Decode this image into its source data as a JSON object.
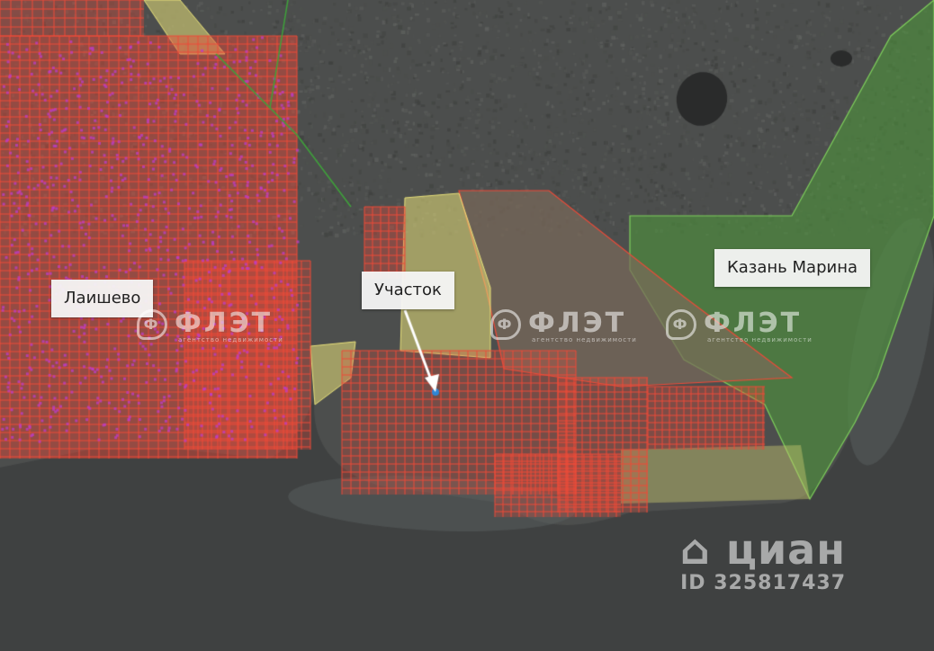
{
  "map": {
    "labels": {
      "town": "Лаишево",
      "plot": "Участок",
      "marina": "Казань Марина"
    },
    "watermarks": {
      "agency_brand": "ФЛЭТ",
      "agency_tagline": "агентство недвижимости",
      "cian_brand": "циан",
      "listing_id": "ID 325817437"
    },
    "colors": {
      "water": "#3f4141",
      "forest": "#4c4e4d",
      "parcel_red": "#ee4a38",
      "parcel_yellow": "#e8e07a",
      "parcel_green": "#4f9a3a",
      "parcel_brown": "#7a6a5a",
      "plot_marker": "#2e86d6",
      "arrow": "#ffffff"
    }
  }
}
